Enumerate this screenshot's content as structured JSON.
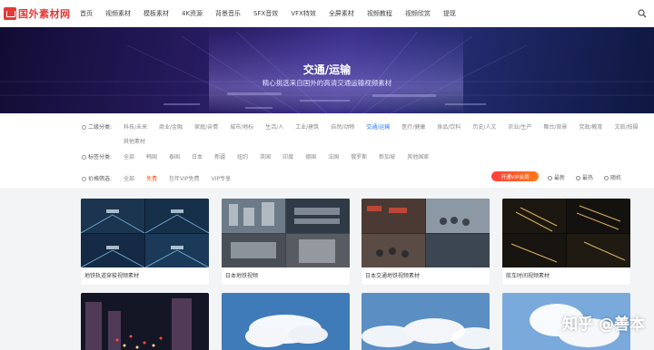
{
  "header": {
    "logo_text": "国外素材网",
    "nav": [
      "首页",
      "视频素材",
      "模板素材",
      "4K资源",
      "背景音乐",
      "SFX音效",
      "VFX特效",
      "全屏素材",
      "视频教程",
      "视频欣赏",
      "提现"
    ]
  },
  "banner": {
    "title": "交通/运输",
    "subtitle": "精心挑选来自国外的高清交通运输视频素材"
  },
  "filters": {
    "category": {
      "label": "二级分类:",
      "options": [
        "科技/未来",
        "商业/金融",
        "家庭/亲情",
        "城市/地标",
        "生活/人",
        "工业/建筑",
        "自然/动物",
        "交通/运输",
        "医疗/健康",
        "食品/饮料",
        "历史/人文",
        "农业/生产",
        "舞台/背景",
        "党政/教育",
        "文旅/拍摄",
        "其他素材"
      ],
      "active": "交通/运输"
    },
    "tags": {
      "label": "标签分类:",
      "options": [
        "全部",
        "韩国",
        "泰国",
        "日本",
        "新疆",
        "纽约",
        "英国",
        "印度",
        "德国",
        "法国",
        "俄罗斯",
        "新加坡",
        "其他国家"
      ]
    },
    "price": {
      "label": "价格筛选:",
      "options": [
        "全部",
        "免费",
        "包年VIP免费",
        "VIP专享"
      ],
      "active": "免费"
    },
    "vip_button": "开通VIP会员",
    "sorts": [
      "最新",
      "最热",
      "随机"
    ]
  },
  "videos": [
    {
      "title": "地铁轨道穿梭视频素材"
    },
    {
      "title": "日本地铁视频"
    },
    {
      "title": "日本交通地铁视频素材"
    },
    {
      "title": "航车时间视频素材"
    }
  ],
  "watermark": "知乎 @善本",
  "colors": {
    "accent": "#2979ff",
    "brand": "#e53935",
    "price": "#ff5722"
  }
}
